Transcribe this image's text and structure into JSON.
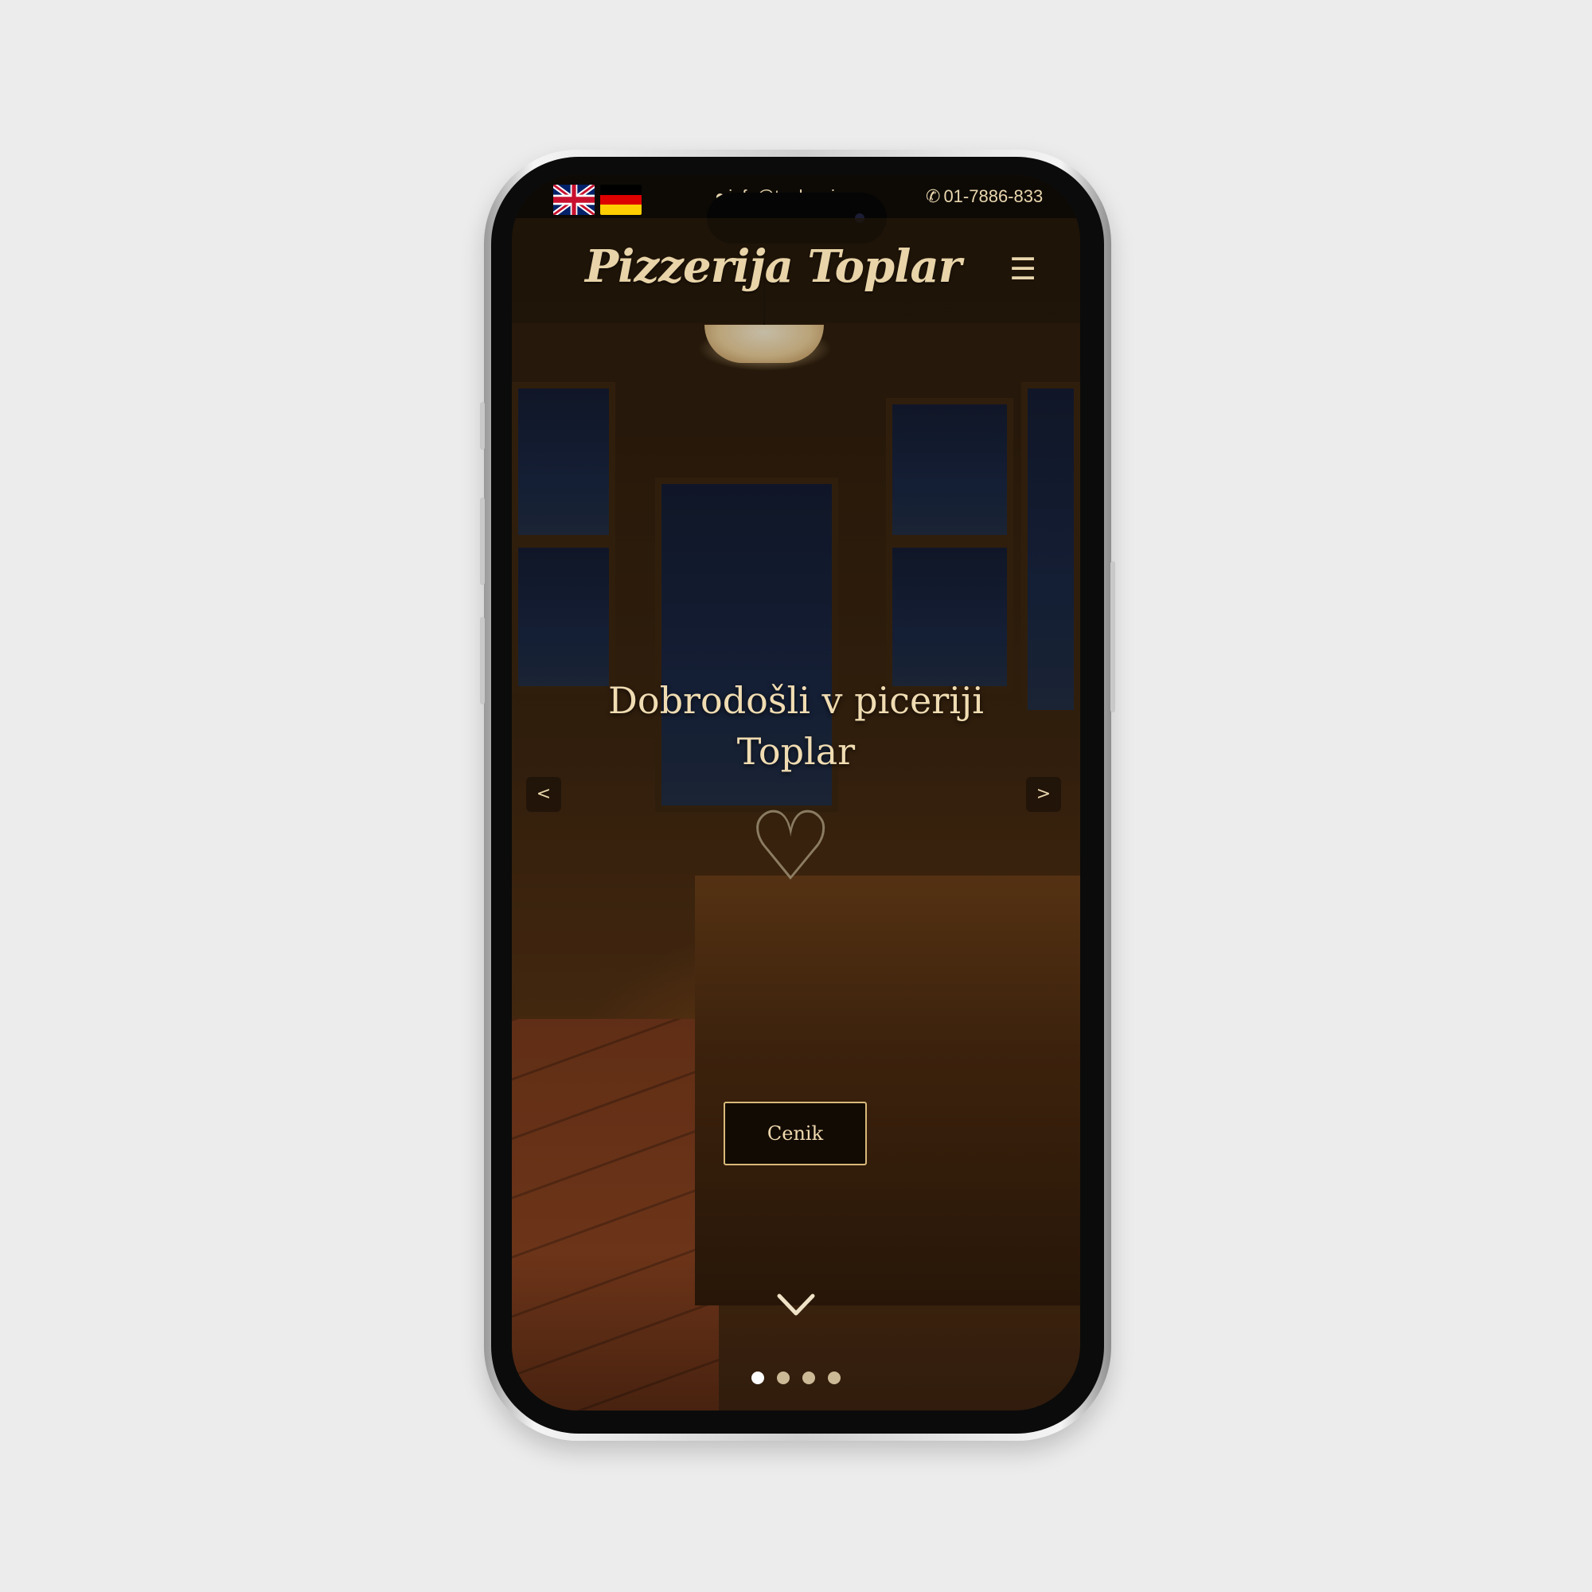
{
  "colors": {
    "accent": "#e9d6ad",
    "button_border": "#d9b97a",
    "page_background": "#ececec"
  },
  "topbar": {
    "languages": [
      {
        "name": "English",
        "icon": "uk-flag-icon"
      },
      {
        "name": "Deutsch",
        "icon": "de-flag-icon"
      }
    ],
    "email": "info@toplar.si",
    "phone": "01-7886-833"
  },
  "header": {
    "logo_text": "Pizzerija Toplar",
    "menu_icon": "hamburger-menu-icon"
  },
  "hero": {
    "title": "Dobrodošli v piceriji Toplar",
    "prev_label": "<",
    "next_label": ">",
    "cta_label": "Cenik",
    "scroll_icon": "chevron-down-icon",
    "slides_total": 4,
    "active_slide": 1
  }
}
